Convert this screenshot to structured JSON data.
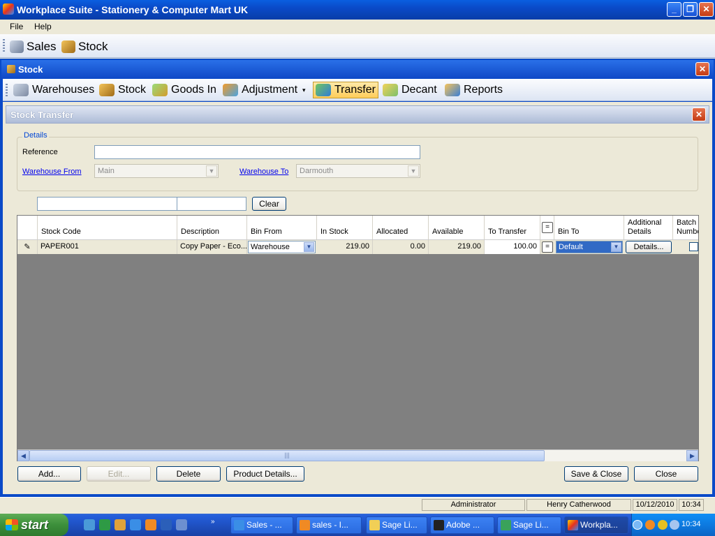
{
  "window": {
    "title": "Workplace Suite - Stationery & Computer Mart UK"
  },
  "menu": {
    "file": "File",
    "help": "Help"
  },
  "modules": {
    "sales": "Sales",
    "stock": "Stock"
  },
  "stock_window": {
    "title": "Stock",
    "toolbar": {
      "warehouses": "Warehouses",
      "stock": "Stock",
      "goods_in": "Goods In",
      "adjustment": "Adjustment",
      "transfer": "Transfer",
      "decant": "Decant",
      "reports": "Reports"
    }
  },
  "transfer": {
    "title": "Stock Transfer",
    "details": {
      "legend": "Details",
      "reference_label": "Reference",
      "reference_value": "",
      "warehouse_from_label": "Warehouse From",
      "warehouse_from_value": "Main",
      "warehouse_to_label": "Warehouse To",
      "warehouse_to_value": "Darmouth"
    },
    "filter": {
      "clear_label": "Clear",
      "search1": "",
      "search2": ""
    },
    "columns": {
      "stock_code": "Stock Code",
      "description": "Description",
      "bin_from": "Bin From",
      "in_stock": "In Stock",
      "allocated": "Allocated",
      "available": "Available",
      "to_transfer": "To Transfer",
      "equals": "=",
      "bin_to": "Bin To",
      "additional_details_1": "Additional",
      "additional_details_2": "Details",
      "batch_1": "Batch",
      "batch_2": "Numbe"
    },
    "rows": [
      {
        "stock_code": "PAPER001",
        "description": "Copy Paper - Eco...",
        "bin_from": "Warehouse",
        "in_stock": "219.00",
        "allocated": "0.00",
        "available": "219.00",
        "to_transfer": "100.00",
        "equals": "=",
        "bin_to": "Default",
        "details_button": "Details..."
      }
    ],
    "buttons": {
      "add": "Add...",
      "edit": "Edit...",
      "delete": "Delete",
      "product_details": "Product Details...",
      "save_close": "Save & Close",
      "close": "Close"
    }
  },
  "status": {
    "user": "Administrator",
    "name": "Henry Catherwood",
    "date": "10/12/2010",
    "time": "10:34"
  },
  "taskbar": {
    "start": "start",
    "tasks": [
      "Sales - ...",
      "sales - I...",
      "Sage Li...",
      "Adobe ...",
      "Sage Li...",
      "Workpla..."
    ],
    "clock": "10:34"
  }
}
